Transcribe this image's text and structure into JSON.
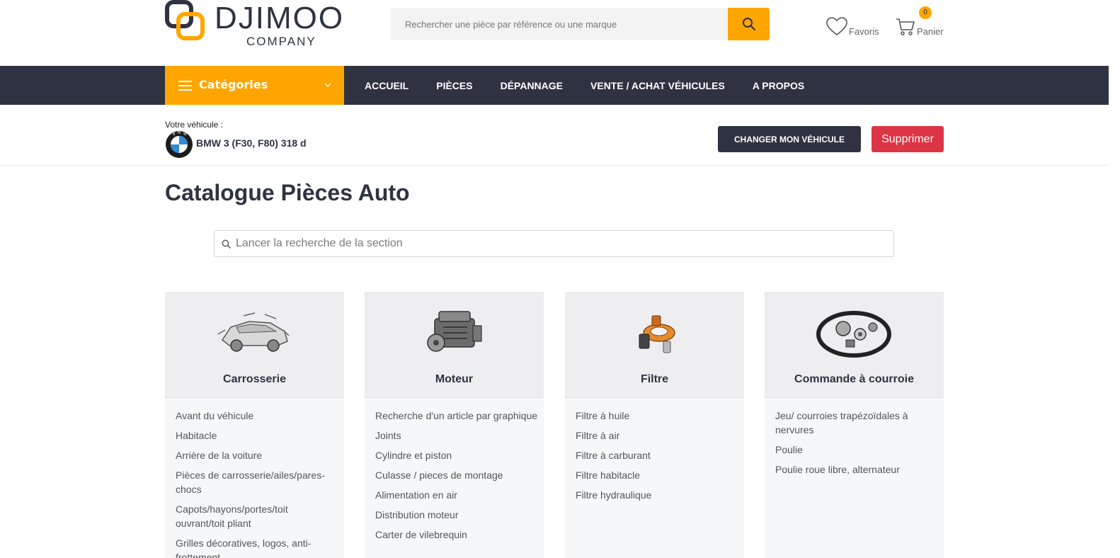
{
  "brand": {
    "name": "DJIMOO",
    "sub": "COMPANY",
    "colors": {
      "accent": "#ffa500",
      "dark": "#2f3341",
      "danger": "#dc3545"
    }
  },
  "header": {
    "search_placeholder": "Rechercher une pièce par référence ou une marque",
    "favorites_label": "Favoris",
    "cart_label": "Panier",
    "cart_count": "0"
  },
  "nav": {
    "categories_label": "Catégories",
    "links": [
      "ACCUEIL",
      "PIÈCES",
      "DÉPANNAGE",
      "VENTE / ACHAT VÉHICULES",
      "A PROPOS"
    ]
  },
  "vehicle": {
    "caption": "Votre véhicule :",
    "name": "BMW 3 (F30, F80) 318 d",
    "change_label": "CHANGER MON VÉHICULE",
    "delete_label": "Supprimer"
  },
  "main": {
    "title": "Catalogue Pièces Auto",
    "section_search_placeholder": "Lancer la recherche de la section"
  },
  "categories": [
    {
      "title": "Carrosserie",
      "icon": "car-body-icon",
      "items": [
        "Avant du véhicule",
        "Habitacle",
        "Arrière de la voiture",
        "Pièces de carrosserie/ailes/pares-chocs",
        "Capots/hayons/portes/toit ouvrant/toit pliant",
        "Grilles décoratives, logos, anti-frottement"
      ]
    },
    {
      "title": "Moteur",
      "icon": "engine-icon",
      "items": [
        "Recherche d'un article par graphique",
        "Joints",
        "Cylindre et piston",
        "Culasse / pieces de montage",
        "Alimentation en air",
        "Distribution moteur",
        "Carter de vilebrequin"
      ]
    },
    {
      "title": "Filtre",
      "icon": "filter-icon",
      "items": [
        "Filtre à huile",
        "Filtre à air",
        "Filtre à carburant",
        "Filtre habitacle",
        "Filtre hydraulique"
      ]
    },
    {
      "title": "Commande à courroie",
      "icon": "belt-icon",
      "items": [
        "Jeu/ courroies trapézoïdales à nervures",
        "Poulie",
        "Poulie roue libre, alternateur"
      ]
    }
  ]
}
